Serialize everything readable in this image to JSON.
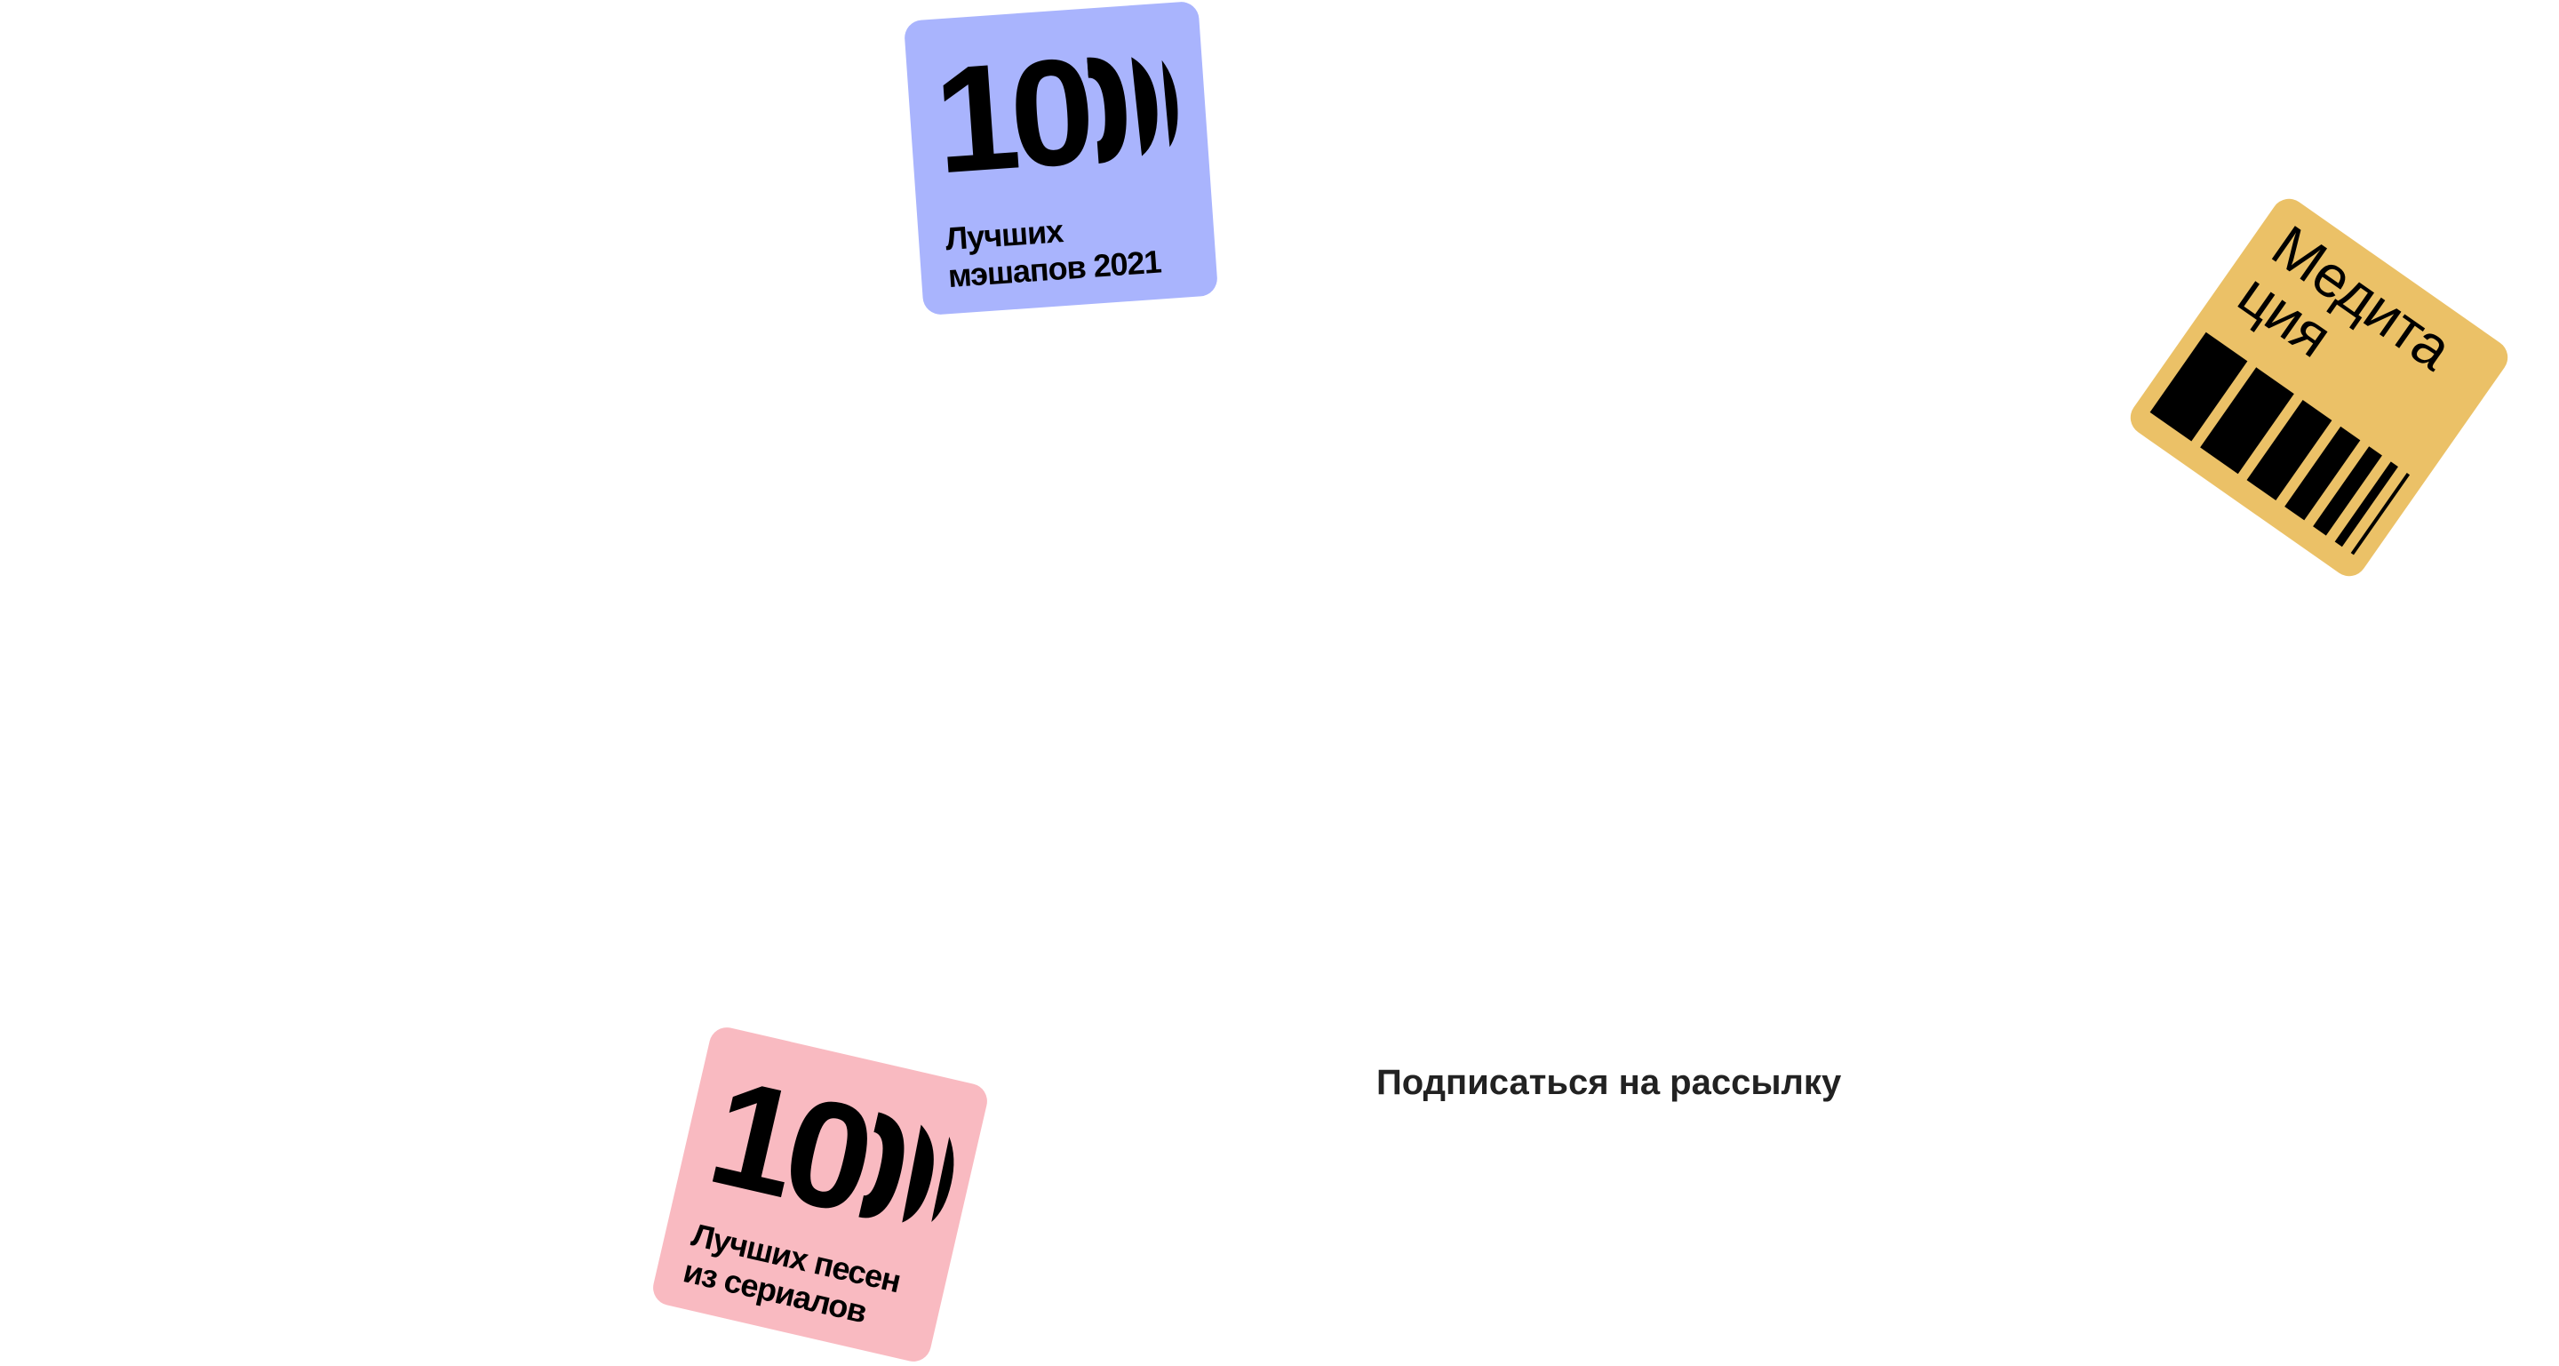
{
  "cards": [
    {
      "number": "10",
      "subtitle_line1": "Лучших",
      "subtitle_line2": "мэшапов 2021",
      "color": "#a9b4fd"
    },
    {
      "title_line1": "Медита",
      "title_line2": "ция",
      "color": "#ebc167"
    },
    {
      "number": "10",
      "subtitle_line1": "Лучших песен",
      "subtitle_line2": "из сериалов",
      "color": "#f9bac1"
    }
  ],
  "subscribe_label": "Подписаться на рассылку"
}
